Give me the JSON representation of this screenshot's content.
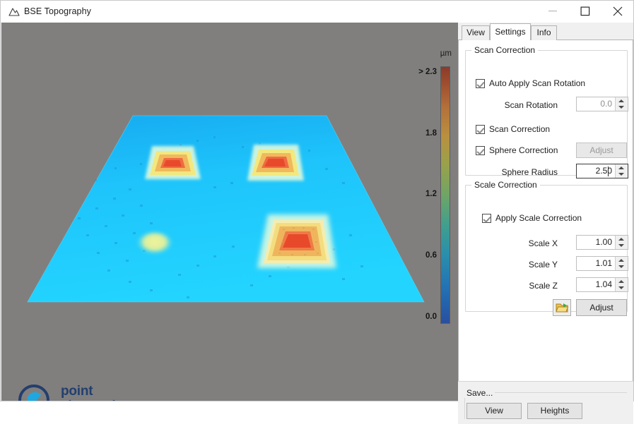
{
  "window": {
    "title": "BSE Topography",
    "icon": "mountain-icon",
    "controls": {
      "minimize": "minimize-icon",
      "maximize": "maximize-icon",
      "close": "close-icon"
    }
  },
  "plot": {
    "background_color": "#807f7e",
    "surface_color_low": "#1ec8ff",
    "logo": {
      "line1": "point",
      "line2": "electronic",
      "mark_color": "#1fa8e0",
      "text_color": "#233f6e"
    },
    "colorbar": {
      "unit": "µm",
      "ticks": [
        "> 2.3",
        "1.8",
        "1.2",
        "0.6",
        "0.0"
      ],
      "tick_values": [
        2.3,
        1.8,
        1.2,
        0.6,
        0.0
      ],
      "top_color": "#8b3a2a",
      "bottom_color": "#2b4f9e"
    }
  },
  "tabs": [
    {
      "label": "View",
      "active": false
    },
    {
      "label": "Settings",
      "active": true
    },
    {
      "label": "Info",
      "active": false
    }
  ],
  "settings": {
    "scan_correction": {
      "title": "Scan Correction",
      "auto_apply_label": "Auto Apply Scan Rotation",
      "auto_apply_checked": true,
      "scan_rotation_label": "Scan Rotation",
      "scan_rotation_value": "0.0",
      "scan_correction_label": "Scan Correction",
      "scan_correction_checked": true,
      "sphere_correction_label": "Sphere Correction",
      "sphere_correction_checked": true,
      "sphere_adjust_label": "Adjust",
      "sphere_radius_label": "Sphere Radius",
      "sphere_radius_value": "2.50"
    },
    "scale_correction": {
      "title": "Scale Correction",
      "apply_label": "Apply Scale Correction",
      "apply_checked": true,
      "scale_x_label": "Scale X",
      "scale_x_value": "1.00",
      "scale_y_label": "Scale Y",
      "scale_y_value": "1.01",
      "scale_z_label": "Scale Z",
      "scale_z_value": "1.04",
      "open_icon": "folder-open-icon",
      "adjust_label": "Adjust"
    }
  },
  "save": {
    "title": "Save...",
    "view_label": "View",
    "heights_label": "Heights"
  }
}
